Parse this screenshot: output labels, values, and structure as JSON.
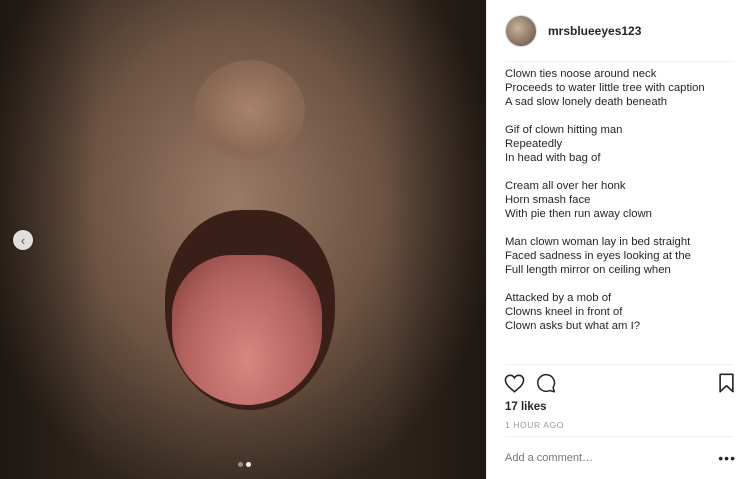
{
  "post": {
    "username": "mrsblueeyes123",
    "caption_stanzas": [
      [
        "Clown ties noose around neck",
        "Proceeds to water little tree with caption",
        "A sad slow lonely death beneath"
      ],
      [
        "Gif of clown hitting man",
        "Repeatedly",
        "In head with bag of"
      ],
      [
        "Cream all over her honk",
        "Horn smash face",
        "With pie then run away clown"
      ],
      [
        "Man clown woman lay in bed straight",
        "Faced sadness in eyes looking at the",
        "Full length mirror on ceiling when"
      ],
      [
        "Attacked by a mob of",
        "Clowns kneel in front of",
        "Clown asks but what am I?"
      ]
    ],
    "likes": "17 likes",
    "time": "1 HOUR AGO",
    "comment_placeholder": "Add a comment…",
    "more_glyph": "•••"
  },
  "carousel": {
    "slide_count": 2,
    "active_index": 1,
    "prev_glyph": "‹"
  },
  "icons": [
    "heart-icon",
    "comment-icon",
    "bookmark-icon",
    "chevron-left-icon"
  ]
}
